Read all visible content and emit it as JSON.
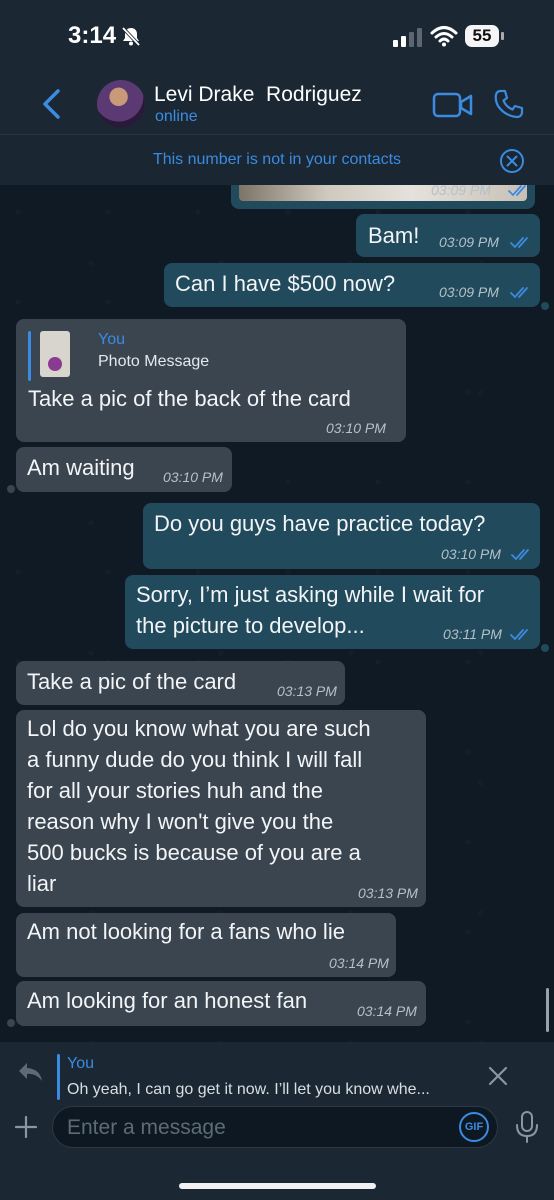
{
  "status_bar": {
    "time": "3:14",
    "battery": "55"
  },
  "header": {
    "contact_name": "Levi Drake  Rodriguez",
    "contact_status": "online"
  },
  "banner": {
    "text": "This number is not in your contacts"
  },
  "messages": [
    {
      "dir": "out",
      "type": "photo",
      "time": "03:09 PM"
    },
    {
      "dir": "out",
      "text": "Bam!",
      "time": "03:09 PM"
    },
    {
      "dir": "out",
      "text": "Can I have $500 now?",
      "time": "03:09 PM"
    },
    {
      "dir": "in",
      "quote_author": "You",
      "quote_text": "Photo Message",
      "text": "Take a pic of the back of the card",
      "time": "03:10 PM"
    },
    {
      "dir": "in",
      "text": "Am waiting",
      "time": "03:10 PM"
    },
    {
      "dir": "out",
      "text": "Do you guys have practice today?",
      "time": "03:10 PM"
    },
    {
      "dir": "out",
      "lines": [
        "Sorry, I’m just asking while I wait for",
        "the picture to develop..."
      ],
      "time": "03:11 PM"
    },
    {
      "dir": "in",
      "text": "Take a pic of the card",
      "time": "03:13 PM"
    },
    {
      "dir": "in",
      "lines": [
        "Lol do you know what you are such",
        "a funny dude do you think I will fall",
        "for all your stories huh and the",
        "reason why I won't give you the",
        "500 bucks is because of you are a",
        "liar"
      ],
      "time": "03:13 PM"
    },
    {
      "dir": "in",
      "text": "Am not looking for a fans who lie",
      "time": "03:14 PM"
    },
    {
      "dir": "in",
      "text": "Am looking for an honest fan",
      "time": "03:14 PM"
    }
  ],
  "reply": {
    "author": "You",
    "text": "Oh yeah, I can go get it now. I’ll let you know whe..."
  },
  "input": {
    "placeholder": "Enter a message",
    "gif_label": "GIF"
  },
  "colors": {
    "accent": "#3b8be0",
    "outgoing_bubble": "#214a5c",
    "incoming_bubble": "#3a4550"
  }
}
